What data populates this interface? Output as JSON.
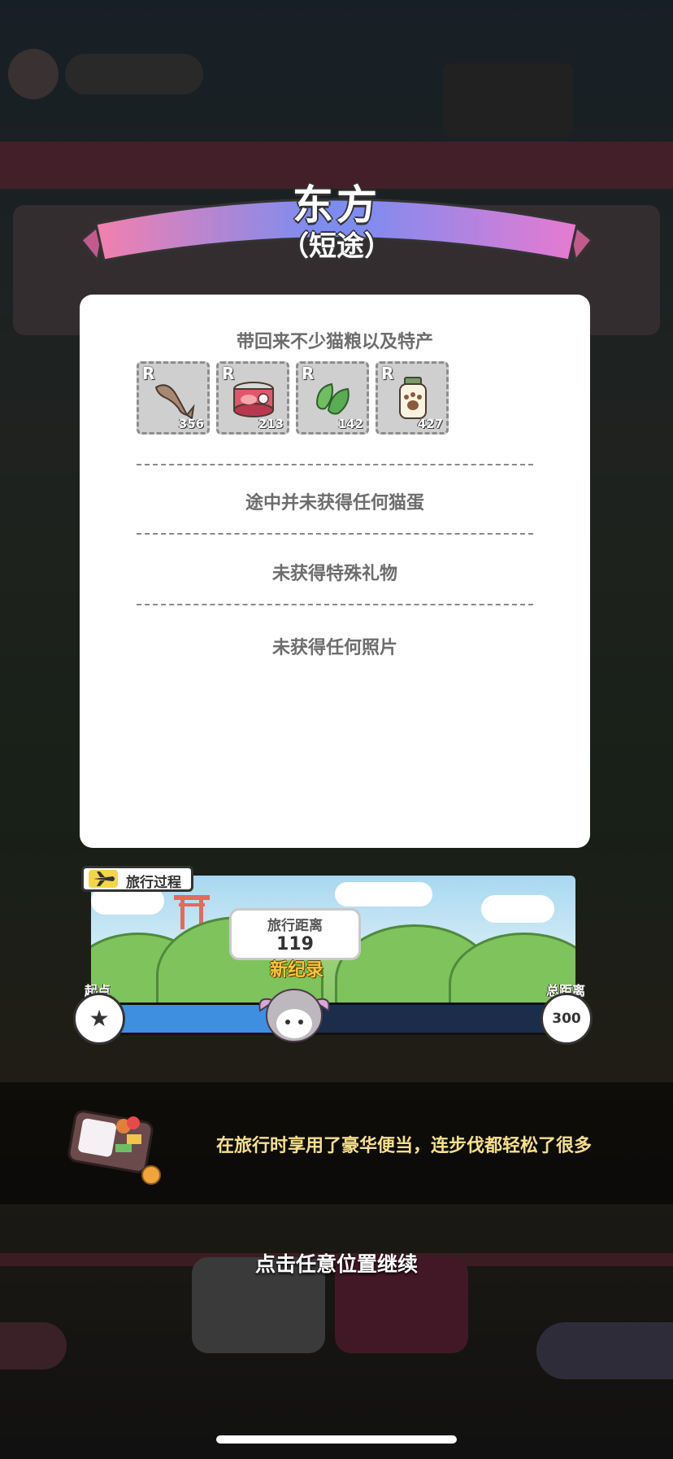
{
  "destination": {
    "title": "东方",
    "subtitle": "（短途）"
  },
  "rewards": {
    "heading": "带回来不少猫粮以及特产",
    "items": [
      {
        "rank": "R",
        "count": "356",
        "icon": "dried-fish-icon"
      },
      {
        "rank": "R",
        "count": "213",
        "icon": "canned-food-icon"
      },
      {
        "rank": "R",
        "count": "142",
        "icon": "leaf-icon"
      },
      {
        "rank": "R",
        "count": "427",
        "icon": "paw-jar-icon"
      }
    ]
  },
  "results": {
    "eggs": "途中并未获得任何猫蛋",
    "gift": "未获得特殊礼物",
    "photo": "未获得任何照片"
  },
  "travel": {
    "tag_label": "旅行过程",
    "distance_label": "旅行距离",
    "distance_value": "119",
    "record_label": "新纪录",
    "start_label": "起点",
    "start_icon": "★",
    "total_label": "总距离",
    "total_value": "300",
    "progress": 0.397
  },
  "bento": {
    "message": "在旅行时享用了豪华便当，连步伐都轻松了很多"
  },
  "continue_hint": "点击任意位置继续",
  "colors": {
    "ribbon_left": "#f47fae",
    "ribbon_mid": "#7e8cf0",
    "accent_yellow": "#f6c53a",
    "track_blue": "#3f8fe0"
  }
}
